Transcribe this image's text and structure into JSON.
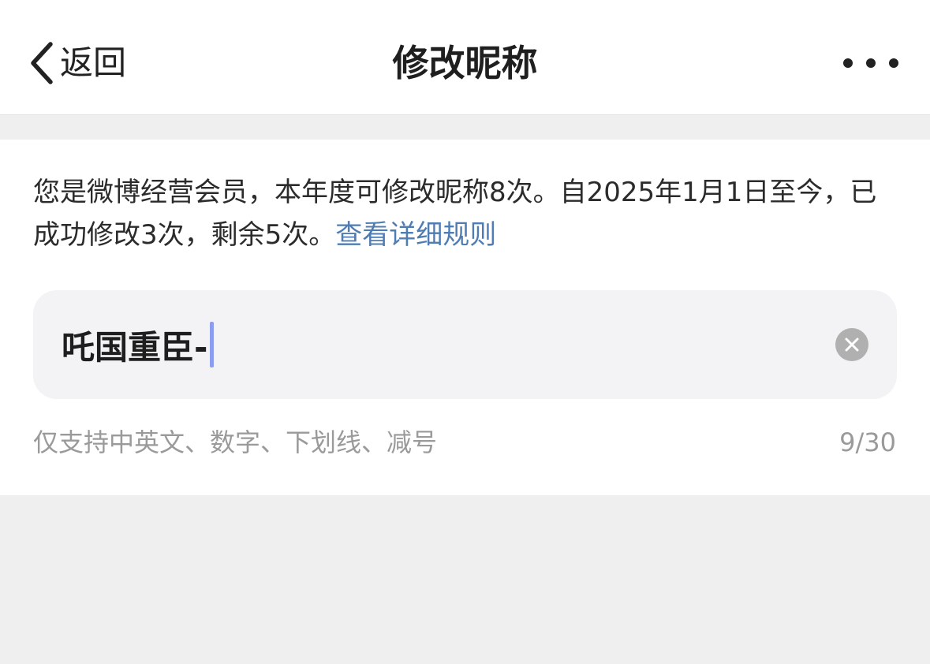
{
  "nav": {
    "back_label": "返回",
    "title": "修改昵称",
    "more_icon": "more-dots-icon"
  },
  "notice": {
    "text": "您是微博经营会员，本年度可修改昵称8次。自2025年1月1日至今，已成功修改3次，剩余5次。",
    "link_label": "查看详细规则"
  },
  "nickname_input": {
    "value": "吒国重臣-",
    "clear_icon": "clear-icon"
  },
  "hint": {
    "text": "仅支持中英文、数字、下划线、减号",
    "counter": "9/30"
  },
  "colors": {
    "link": "#4f7db3",
    "caret": "#8c9df0",
    "background": "#efefef",
    "panel": "#ffffff",
    "input_bg": "#f3f3f5"
  }
}
